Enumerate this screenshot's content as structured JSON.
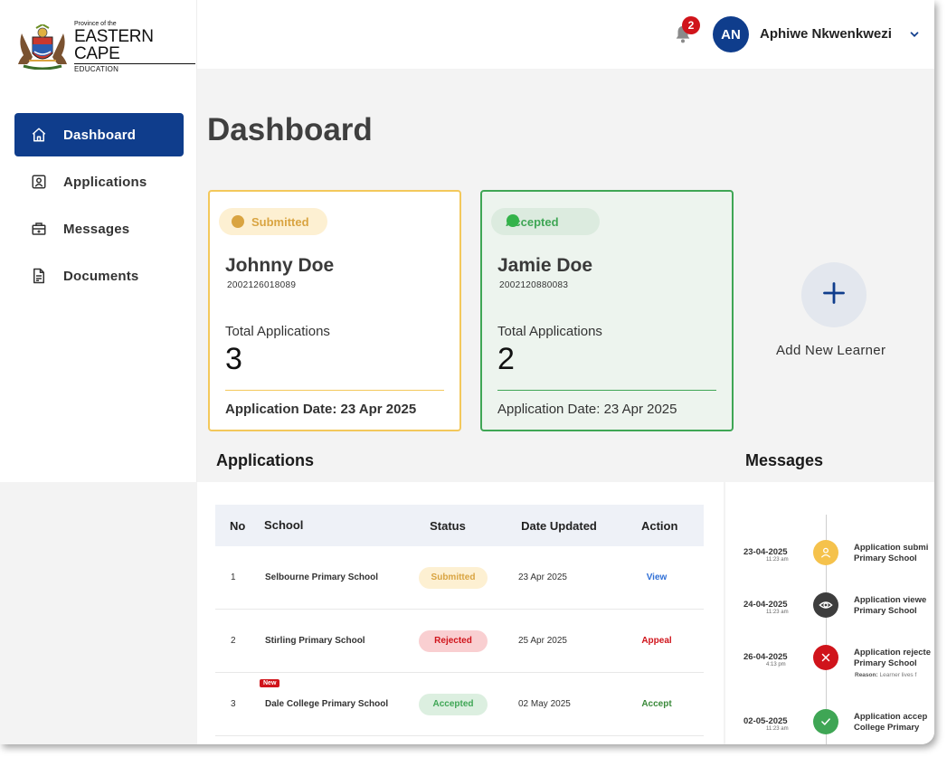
{
  "brand": {
    "province": "Province of the",
    "name": "EASTERN CAPE",
    "department": "EDUCATION"
  },
  "sidebar": {
    "items": [
      {
        "label": "Dashboard",
        "icon": "home-icon",
        "active": true
      },
      {
        "label": "Applications",
        "icon": "user-badge-icon",
        "active": false
      },
      {
        "label": "Messages",
        "icon": "briefcase-medical-icon",
        "active": false
      },
      {
        "label": "Documents",
        "icon": "document-icon",
        "active": false
      }
    ]
  },
  "header": {
    "notifications_count": "2",
    "user_initials": "AN",
    "user_name": "Aphiwe Nkwenkwezi"
  },
  "page_title": "Dashboard",
  "learners": [
    {
      "status": "Submitted",
      "name": "Johnny Doe",
      "id_number": "2002126018089",
      "total_label": "Total Applications",
      "total": "3",
      "date_label": "Application Date: 23 Apr 2025"
    },
    {
      "status": "Accepted",
      "name": "Jamie Doe",
      "id_number": "2002120880083",
      "total_label": "Total Applications",
      "total": "2",
      "date_label": "Application Date: 23 Apr 2025"
    }
  ],
  "add_learner_label": "Add New Learner",
  "applications": {
    "title": "Applications",
    "columns": [
      "No",
      "School",
      "Status",
      "Date Updated",
      "Action"
    ],
    "rows": [
      {
        "no": "1",
        "school": "Selbourne Primary School",
        "status": "Submitted",
        "date": "23 Apr 2025",
        "action": "View",
        "new": ""
      },
      {
        "no": "2",
        "school": "Stirling Primary School",
        "status": "Rejected",
        "date": "25 Apr 2025",
        "action": "Appeal",
        "new": ""
      },
      {
        "no": "3",
        "school": "Dale College Primary School",
        "status": "Accepted",
        "date": "02 May 2025",
        "action": "Accept",
        "new": "New"
      }
    ]
  },
  "messages": {
    "title": "Messages",
    "items": [
      {
        "date": "23-04-2025",
        "time": "11:23 am",
        "text1": "Application submi",
        "text2": "Primary School",
        "reason_label": "",
        "reason": "",
        "icon": "user-icon"
      },
      {
        "date": "24-04-2025",
        "time": "11:23 am",
        "text1": "Application viewe",
        "text2": "Primary School",
        "reason_label": "",
        "reason": "",
        "icon": "eye-icon"
      },
      {
        "date": "26-04-2025",
        "time": "4:13 pm",
        "text1": "Application rejecte",
        "text2": "Primary School",
        "reason_label": "Reason:",
        "reason": "Learner lives f",
        "icon": "close-icon"
      },
      {
        "date": "02-05-2025",
        "time": "11:23 am",
        "text1": "Application accep",
        "text2": "College Primary",
        "reason_label": "",
        "reason": "",
        "icon": "check-icon"
      }
    ]
  },
  "colors": {
    "primary": "#0f3d8c",
    "submitted": "#d9a441",
    "accepted": "#3fa655",
    "rejected": "#d0141b"
  }
}
